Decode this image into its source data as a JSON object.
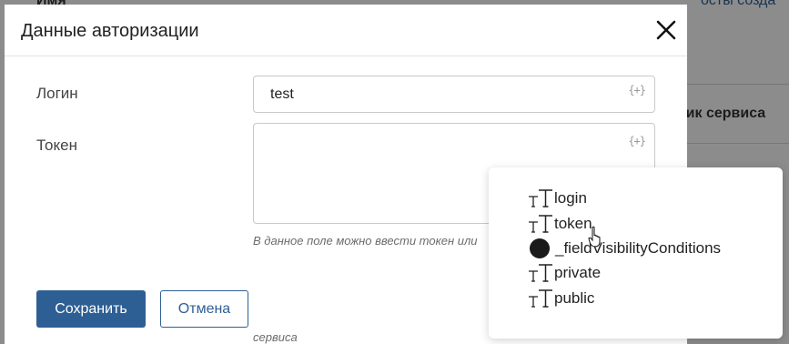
{
  "background": {
    "col_header_top": "Имя",
    "col_header_right_top": "осты созда",
    "right_text": "ник сервиса"
  },
  "modal": {
    "title": "Данные авторизации",
    "fields": {
      "login": {
        "label": "Логин",
        "value": "test",
        "var_button": "{+}"
      },
      "token": {
        "label": "Токен",
        "value": "",
        "var_button": "{+}"
      }
    },
    "hint": "В данное поле можно ввести токен или",
    "hint_2": "сервиса",
    "buttons": {
      "save": "Сохранить",
      "cancel": "Отмена"
    }
  },
  "popup": {
    "items": [
      {
        "label": "login",
        "icon": "text-type-icon"
      },
      {
        "label": "token",
        "icon": "text-type-icon"
      },
      {
        "label": "_fieldVisibilityConditions",
        "icon": "object-type-icon"
      },
      {
        "label": "private",
        "icon": "text-type-icon"
      },
      {
        "label": "public",
        "icon": "text-type-icon"
      }
    ]
  },
  "colors": {
    "primary": "#2e5f94",
    "overlay": "#8f8f8f"
  }
}
